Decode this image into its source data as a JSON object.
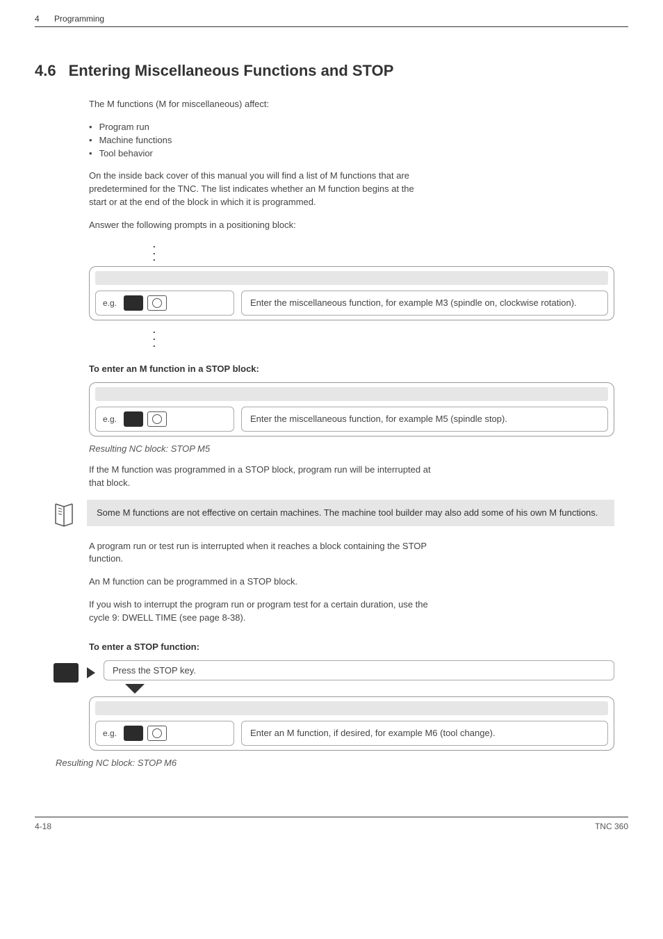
{
  "header": {
    "chapter_num": "4",
    "chapter_title": "Programming"
  },
  "section": {
    "number": "4.6",
    "title": "Entering Miscellaneous Functions and STOP"
  },
  "intro": {
    "lead": "The M functions (M for miscellaneous) affect:",
    "bullets": [
      "Program run",
      "Machine functions",
      "Tool behavior"
    ],
    "para1": "On the inside back cover of this manual you will find a list of M functions that are predetermined for the TNC. The list indicates whether an M function begins at the start or at the end of the block in which it is programmed.",
    "para2": "Answer the following prompts in a positioning block:"
  },
  "prompt1": {
    "eg": "e.g.",
    "desc": "Enter the miscellaneous function, for example M3 (spindle on, clockwise rotation)."
  },
  "stop_block": {
    "heading": "To enter an M function in a STOP block:",
    "eg": "e.g.",
    "desc": "Enter the miscellaneous function, for example M5 (spindle stop).",
    "result": "Resulting NC block: STOP M5",
    "after1": "If the M function was programmed in a STOP block, program run will be interrupted at that block."
  },
  "info": {
    "text": "Some M functions are not effective on certain machines. The machine tool builder may also add some of his own M functions."
  },
  "paras": {
    "p1": "A program run or test run is interrupted when it reaches a block containing the STOP function.",
    "p2": "An M function can be programmed in a STOP block.",
    "p3": "If you wish to interrupt the program run or program test for a certain duration, use the cycle 9: DWELL TIME (see page 8-38)."
  },
  "stop_func": {
    "heading": "To enter a STOP function:",
    "press": "Press the STOP key.",
    "eg": "e.g.",
    "desc": "Enter an M function, if desired, for example M6 (tool change).",
    "result": "Resulting NC block: STOP M6"
  },
  "footer": {
    "left": "4-18",
    "right": "TNC 360"
  }
}
